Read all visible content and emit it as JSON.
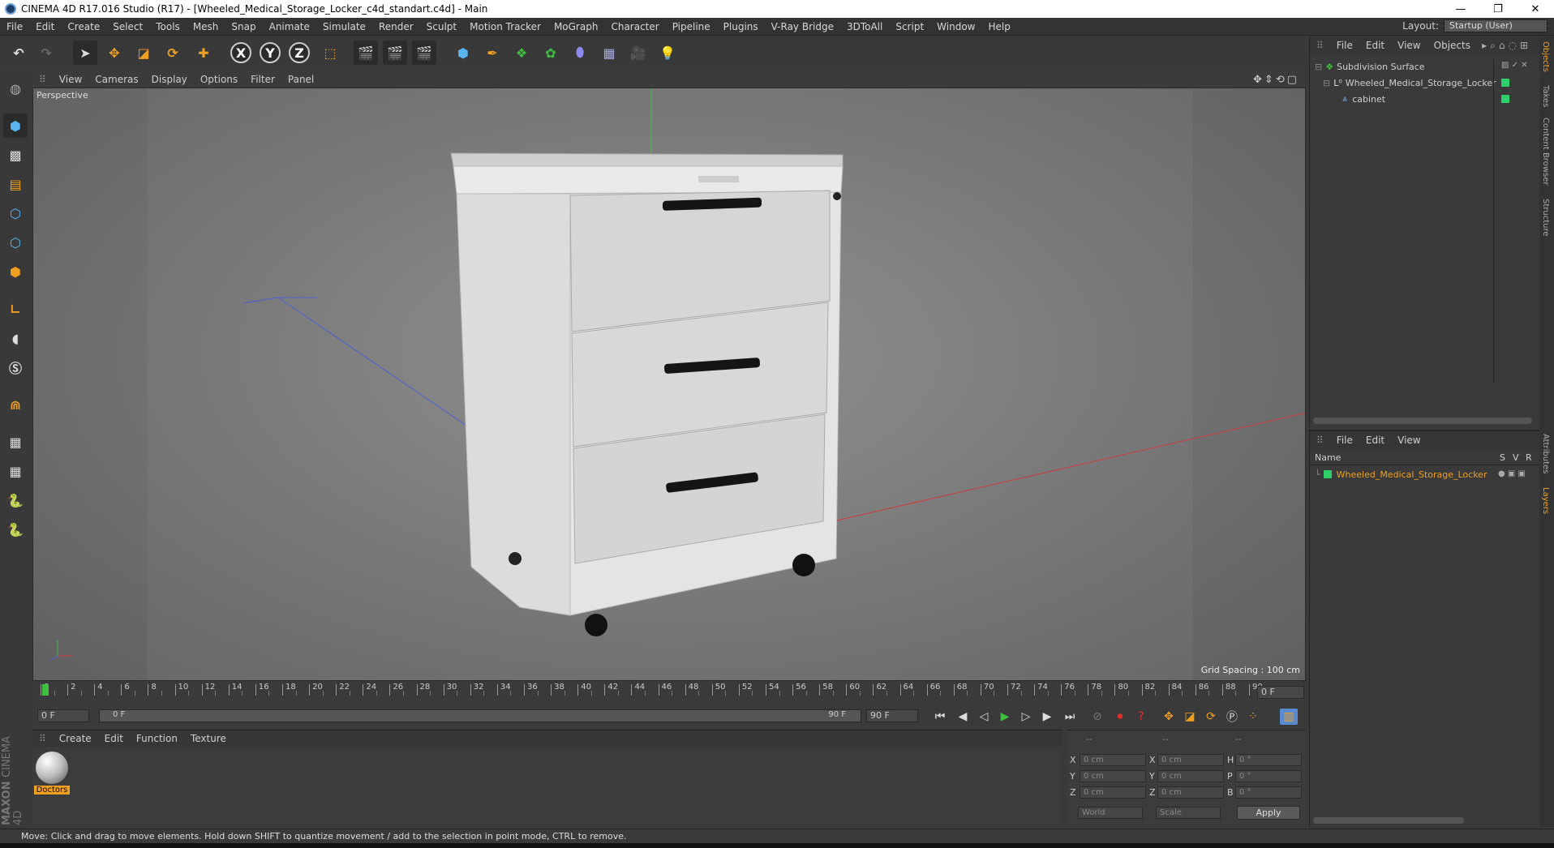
{
  "window": {
    "title": "CINEMA 4D R17.016 Studio (R17) - [Wheeled_Medical_Storage_Locker_c4d_standart.c4d] - Main",
    "controls": [
      "—",
      "❐",
      "✕"
    ]
  },
  "menubar": {
    "items": [
      "File",
      "Edit",
      "Create",
      "Select",
      "Tools",
      "Mesh",
      "Snap",
      "Animate",
      "Simulate",
      "Render",
      "Sculpt",
      "Motion Tracker",
      "MoGraph",
      "Character",
      "Pipeline",
      "Plugins",
      "V-Ray Bridge",
      "3DToAll",
      "Script",
      "Window",
      "Help"
    ],
    "layout_label": "Layout:",
    "layout_value": "Startup (User)"
  },
  "toolbar": {
    "axis_x": "X",
    "axis_y": "Y",
    "axis_z": "Z"
  },
  "viewport": {
    "menu": [
      "View",
      "Cameras",
      "Display",
      "Options",
      "Filter",
      "Panel"
    ],
    "label": "Perspective",
    "grid_spacing": "Grid Spacing : 100 cm"
  },
  "timeline": {
    "ticks": [
      "0",
      "2",
      "4",
      "6",
      "8",
      "10",
      "12",
      "14",
      "16",
      "18",
      "20",
      "22",
      "24",
      "26",
      "28",
      "30",
      "32",
      "34",
      "36",
      "38",
      "40",
      "42",
      "44",
      "46",
      "48",
      "50",
      "52",
      "54",
      "56",
      "58",
      "60",
      "62",
      "64",
      "66",
      "68",
      "70",
      "72",
      "74",
      "76",
      "78",
      "80",
      "82",
      "84",
      "86",
      "88",
      "90"
    ],
    "current_frame": "0 F",
    "start_field": "0 F",
    "range_start": "0 F",
    "range_end": "90 F",
    "end_field": "90 F"
  },
  "materials": {
    "menu": [
      "Create",
      "Edit",
      "Function",
      "Texture"
    ],
    "items": [
      {
        "name": "Doctors"
      }
    ]
  },
  "coordinates": {
    "headers": [
      "--",
      "--",
      "--"
    ],
    "rows": [
      {
        "l1": "X",
        "v1": "0 cm",
        "l2": "X",
        "v2": "0 cm",
        "l3": "H",
        "v3": "0 °"
      },
      {
        "l1": "Y",
        "v1": "0 cm",
        "l2": "Y",
        "v2": "0 cm",
        "l3": "P",
        "v3": "0 °"
      },
      {
        "l1": "Z",
        "v1": "0 cm",
        "l2": "Z",
        "v2": "0 cm",
        "l3": "B",
        "v3": "0 °"
      }
    ],
    "mode1": "World",
    "mode2": "Scale",
    "apply": "Apply"
  },
  "objects_panel": {
    "menu": [
      "File",
      "Edit",
      "View",
      "Objects"
    ],
    "tree": [
      "Subdivision Surface",
      "Wheeled_Medical_Storage_Locker",
      "cabinet"
    ]
  },
  "layers_panel": {
    "menu": [
      "File",
      "Edit",
      "View"
    ],
    "col_name": "Name",
    "col_s": "S",
    "col_v": "V",
    "col_r": "R",
    "rows": [
      "Wheeled_Medical_Storage_Locker"
    ]
  },
  "right_tabs": [
    "Objects",
    "Takes",
    "Content Browser",
    "Structure",
    "Attributes",
    "Layers"
  ],
  "statusbar": {
    "text": "Move: Click and drag to move elements. Hold down SHIFT to quantize movement / add to the selection in point mode, CTRL to remove."
  },
  "brand": {
    "line1": "MAXON",
    "line2": "CINEMA 4D"
  },
  "colors": {
    "accent_orange": "#f0a020",
    "layer_green": "#2ed06a",
    "axis_x": "#d23a3a",
    "axis_y": "#3fbf3f",
    "axis_z": "#4a5fd6"
  }
}
